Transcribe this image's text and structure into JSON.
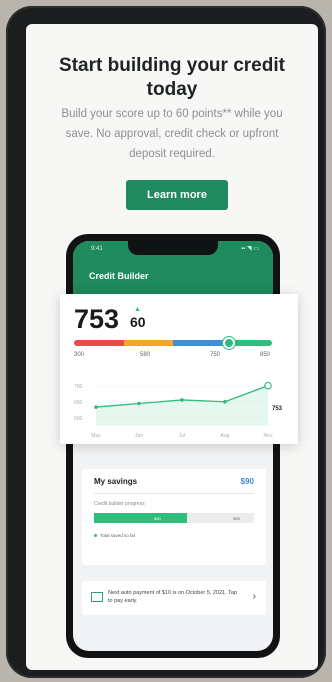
{
  "promo": {
    "headline": "Start building your credit today",
    "subtext": "Build your score up to 60 points** while you save. No approval, credit check or upfront deposit required.",
    "cta_label": "Learn more"
  },
  "app": {
    "status_time": "9:41",
    "status_icons": "▪▪ ◥ ▭",
    "title": "Credit Builder"
  },
  "score_card": {
    "score": "753",
    "change": "60",
    "change_arrow": "▲",
    "caption": "",
    "gauge_ticks": [
      "300",
      "580",
      "750",
      "850"
    ],
    "gauge_level": 753,
    "chart_point_label": "753",
    "chart_point_sub": ""
  },
  "chart_data": {
    "type": "line",
    "x": [
      "May",
      "Jun",
      "Jul",
      "Aug",
      "Nov"
    ],
    "values": [
      693,
      703,
      713,
      708,
      753
    ],
    "ylim": [
      640,
      780
    ],
    "yticks": [
      "700",
      "650",
      "600"
    ],
    "color": "#2fbd7c"
  },
  "savings": {
    "label": "My savings",
    "amount": "$90",
    "program_label": "Credit builder progress",
    "fill_text": "$90",
    "total_text": "$90",
    "progress_fraction": 0.58,
    "legend": "Total saved so far"
  },
  "notice": {
    "text": "Next auto payment of $10 is on October 5, 2021. Tap to pay early.",
    "chevron": "›"
  },
  "colors": {
    "brand_green": "#1f8a5f",
    "gauge": [
      "#e94b4b",
      "#f3a72a",
      "#3f8fd6",
      "#2fbd7c"
    ]
  }
}
